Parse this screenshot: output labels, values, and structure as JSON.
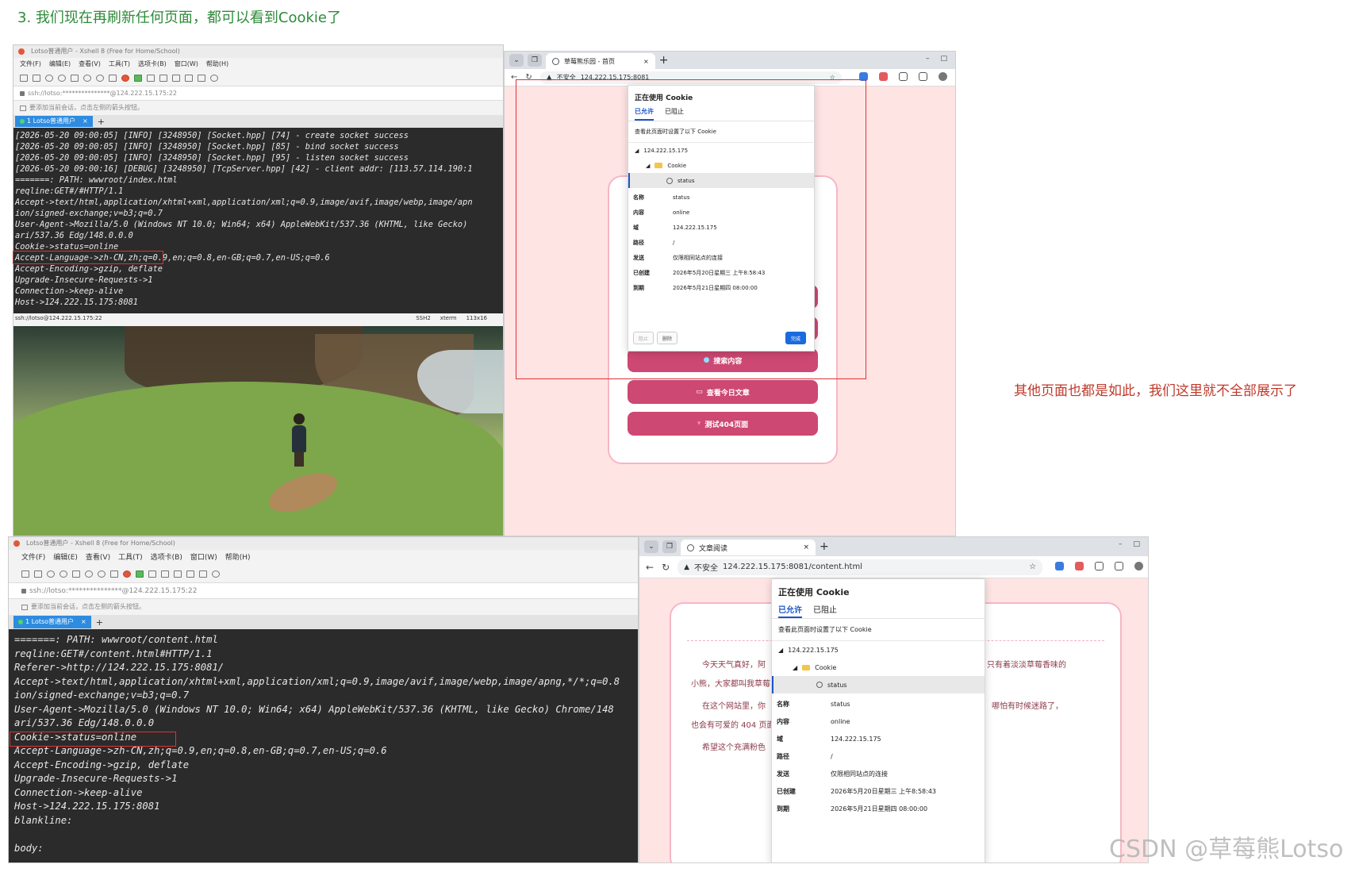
{
  "heading": "3. 我们现在再刷新任何页面，都可以看到Cookie了",
  "side_note": "其他页面也都是如此，我们这里就不全部展示了",
  "watermark": "CSDN @草莓熊Lotso",
  "xshell_top": {
    "title": "Lotso普通用户 - Xshell 8 (Free for Home/School)",
    "menu": [
      "文件(F)",
      "编辑(E)",
      "查看(V)",
      "工具(T)",
      "选项卡(B)",
      "窗口(W)",
      "帮助(H)"
    ],
    "address": "ssh://lotso:***************@124.222.15.175:22",
    "hint": "要添加当前会话，点击左侧的箭头按钮。",
    "tab_label": "1 Lotso普通用户",
    "terminal_lines": [
      "[2026-05-20 09:00:05] [INFO] [3248950] [Socket.hpp] [74] - create socket success",
      "[2026-05-20 09:00:05] [INFO] [3248950] [Socket.hpp] [85] - bind socket success",
      "[2026-05-20 09:00:05] [INFO] [3248950] [Socket.hpp] [95] - listen socket success",
      "[2026-05-20 09:00:16] [DEBUG] [3248950] [TcpServer.hpp] [42] - client addr: [113.57.114.190:1",
      "=======: PATH: wwwroot/index.html",
      "reqline:GET#/#HTTP/1.1",
      "Accept->text/html,application/xhtml+xml,application/xml;q=0.9,image/avif,image/webp,image/apn",
      "ion/signed-exchange;v=b3;q=0.7",
      "User-Agent->Mozilla/5.0 (Windows NT 10.0; Win64; x64) AppleWebKit/537.36 (KHTML, like Gecko)",
      "ari/537.36 Edg/148.0.0.0",
      "Cookie->status=online",
      "Accept-Language->zh-CN,zh;q=0.9,en;q=0.8,en-GB;q=0.7,en-US;q=0.6",
      "Accept-Encoding->gzip, deflate",
      "Upgrade-Insecure-Requests->1",
      "Connection->keep-alive",
      "Host->124.222.15.175:8081"
    ],
    "status_left": "ssh://lotso@124.222.15.175:22",
    "status_ssh": "SSH2",
    "status_term": "xterm",
    "status_size": "113x16"
  },
  "xshell_bottom": {
    "title": "Lotso普通用户 - Xshell 8 (Free for Home/School)",
    "menu": [
      "文件(F)",
      "编辑(E)",
      "查看(V)",
      "工具(T)",
      "选项卡(B)",
      "窗口(W)",
      "帮助(H)"
    ],
    "address": "ssh://lotso:***************@124.222.15.175:22",
    "hint": "要添加当前会话，点击左侧的箭头按钮。",
    "tab_label": "1 Lotso普通用户",
    "terminal_lines": [
      "=======: PATH: wwwroot/content.html",
      "reqline:GET#/content.html#HTTP/1.1",
      "Referer->http://124.222.15.175:8081/",
      "Accept->text/html,application/xhtml+xml,application/xml;q=0.9,image/avif,image/webp,image/apng,*/*;q=0.8",
      "ion/signed-exchange;v=b3;q=0.7",
      "User-Agent->Mozilla/5.0 (Windows NT 10.0; Win64; x64) AppleWebKit/537.36 (KHTML, like Gecko) Chrome/148",
      "ari/537.36 Edg/148.0.0.0",
      "Cookie->status=online",
      "Accept-Language->zh-CN,zh;q=0.9,en;q=0.8,en-GB;q=0.7,en-US;q=0.6",
      "Accept-Encoding->gzip, deflate",
      "Upgrade-Insecure-Requests->1",
      "Connection->keep-alive",
      "Host->124.222.15.175:8081",
      "blankline:",
      "",
      "body:"
    ]
  },
  "browser_top": {
    "tab_title": "草莓熊乐园 - 首页",
    "security": "不安全",
    "url": "124.222.15.175:8081",
    "buttons": [
      "搜索内容",
      "查看今日文章",
      "测试404页面"
    ],
    "popup": {
      "title": "正在使用 Cookie",
      "tab_allowed": "已允许",
      "tab_blocked": "已阻止",
      "description": "查看此页面时设置了以下 Cookie",
      "tree_domain": "124.222.15.175",
      "tree_folder": "Cookie",
      "tree_item": "status",
      "fields": [
        {
          "k": "名称",
          "v": "status"
        },
        {
          "k": "内容",
          "v": "online"
        },
        {
          "k": "域",
          "v": "124.222.15.175"
        },
        {
          "k": "路径",
          "v": "/"
        },
        {
          "k": "发送",
          "v": "仅限相同站点的连接"
        },
        {
          "k": "已创建",
          "v": "2026年5月20日星期三 上午8:58:43"
        },
        {
          "k": "到期",
          "v": "2026年5月21日星期四 08:00:00"
        }
      ],
      "btn_block": "阻止",
      "btn_delete": "删除",
      "btn_done": "完成"
    }
  },
  "browser_bottom": {
    "tab_title": "文章阅读",
    "security": "不安全",
    "url": "124.222.15.175:8081/content.html",
    "article": [
      "今天天气真好，阿",
      "小熊，大家都叫我草莓",
      "在这个网站里，你",
      "也会有可爱的 404 页面",
      "希望这个充满粉色"
    ],
    "article_right": [
      "只有着淡淡草莓香味的",
      "哪怕有时候迷路了，"
    ],
    "popup": {
      "title": "正在使用 Cookie",
      "tab_allowed": "已允许",
      "tab_blocked": "已阻止",
      "description": "查看此页面时设置了以下 Cookie",
      "tree_domain": "124.222.15.175",
      "tree_folder": "Cookie",
      "tree_item": "status",
      "fields": [
        {
          "k": "名称",
          "v": "status"
        },
        {
          "k": "内容",
          "v": "online"
        },
        {
          "k": "域",
          "v": "124.222.15.175"
        },
        {
          "k": "路径",
          "v": "/"
        },
        {
          "k": "发送",
          "v": "仅限相同站点的连接"
        },
        {
          "k": "已创建",
          "v": "2026年5月20日星期三 上午8:58:43"
        },
        {
          "k": "到期",
          "v": "2026年5月21日星期四 08:00:00"
        }
      ]
    }
  },
  "colors": {
    "heading": "#2e8b3a",
    "note": "#c0392b",
    "pink_button": "#cd4872",
    "page_bg": "#ffe4e4",
    "accent_blue": "#1a56c8"
  }
}
